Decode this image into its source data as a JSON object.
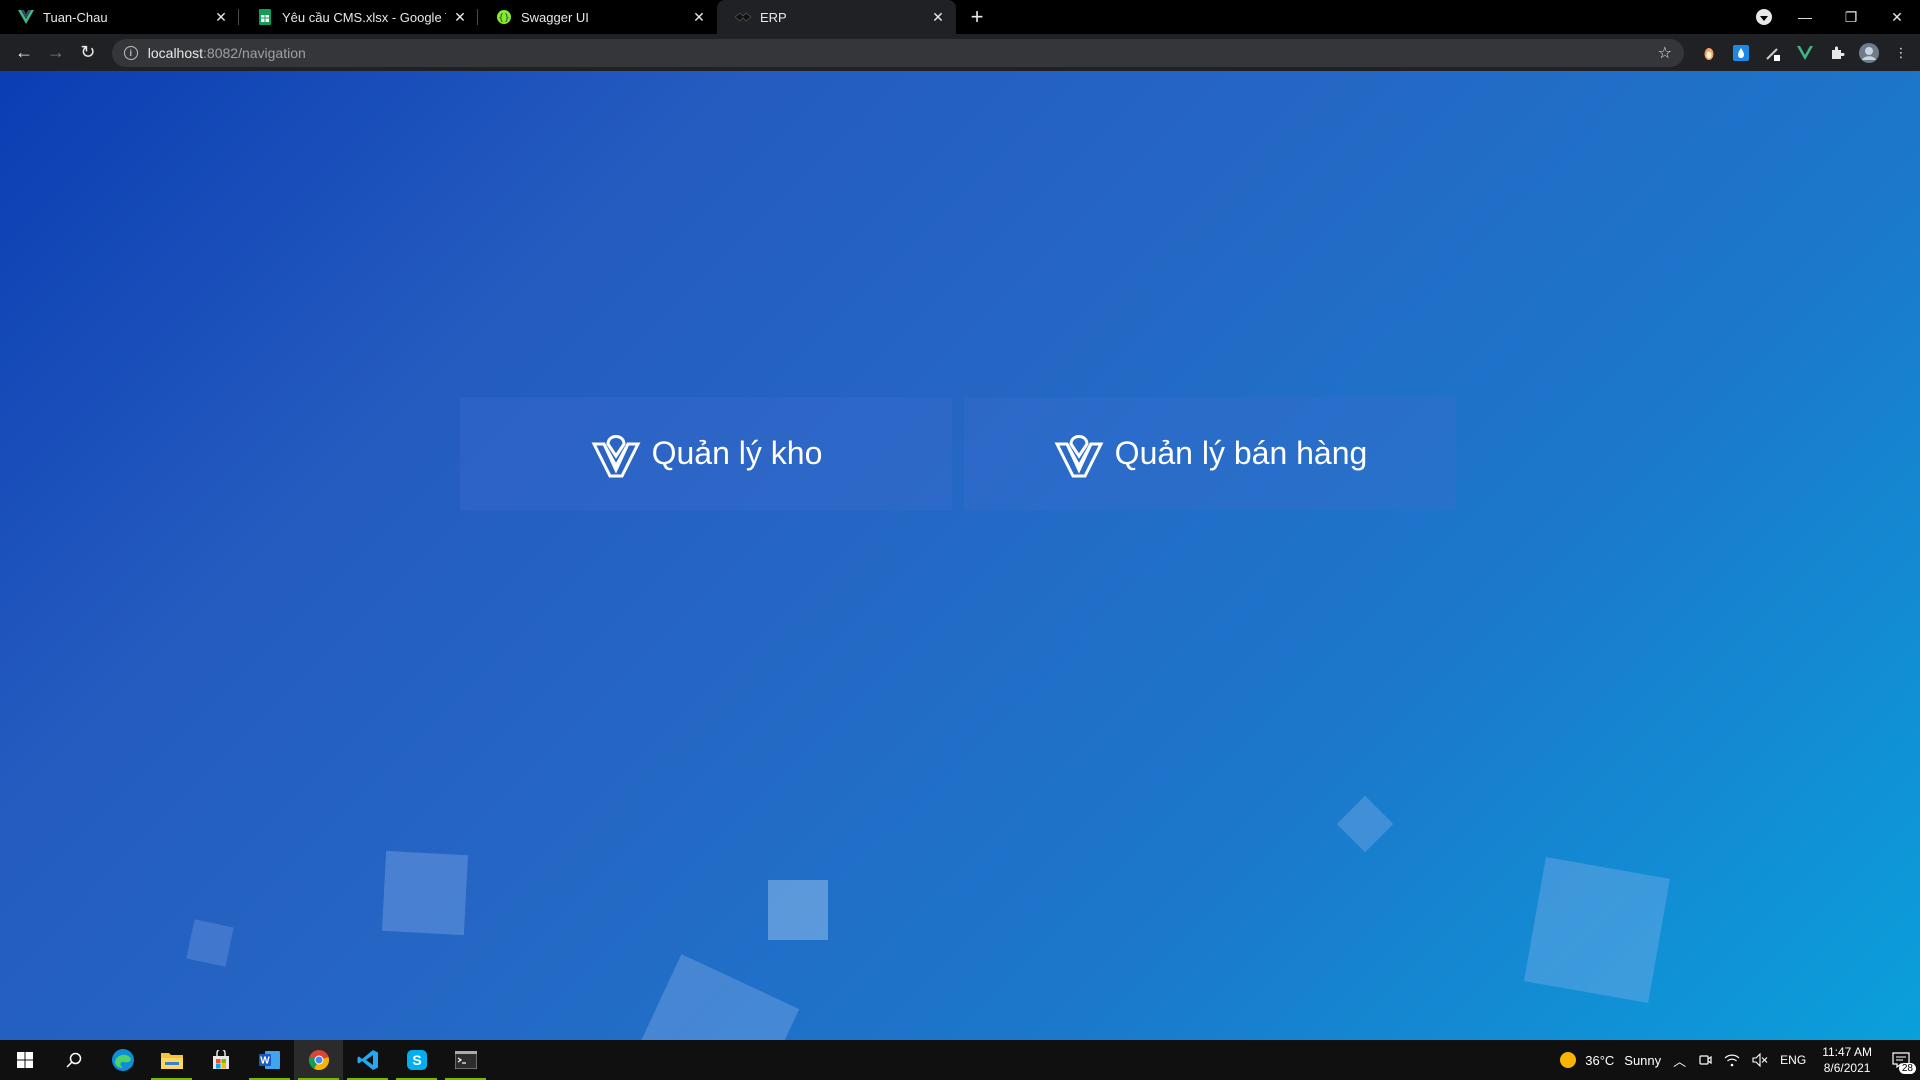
{
  "browser": {
    "tabs": [
      {
        "title": "Tuan-Chau",
        "icon": "vue-icon"
      },
      {
        "title": "Yêu cầu CMS.xlsx - Google Trang tính",
        "icon": "sheets-icon"
      },
      {
        "title": "Swagger UI",
        "icon": "swagger-icon"
      },
      {
        "title": "ERP",
        "icon": "erp-icon"
      }
    ],
    "new_tab_label": "+",
    "url_host": "localhost",
    "url_path": ":8082/navigation"
  },
  "page": {
    "cards": [
      {
        "label": "Quản lý kho"
      },
      {
        "label": "Quản lý bán hàng"
      }
    ]
  },
  "taskbar": {
    "weather_temp": "36°C",
    "weather_text": "Sunny",
    "language": "ENG",
    "time": "11:47 AM",
    "date": "8/6/2021",
    "notifications": "28"
  },
  "colors": {
    "accent_running": "#76b900",
    "page_gradient_start": "#0a3db3",
    "page_gradient_end": "#0aa0dc"
  }
}
